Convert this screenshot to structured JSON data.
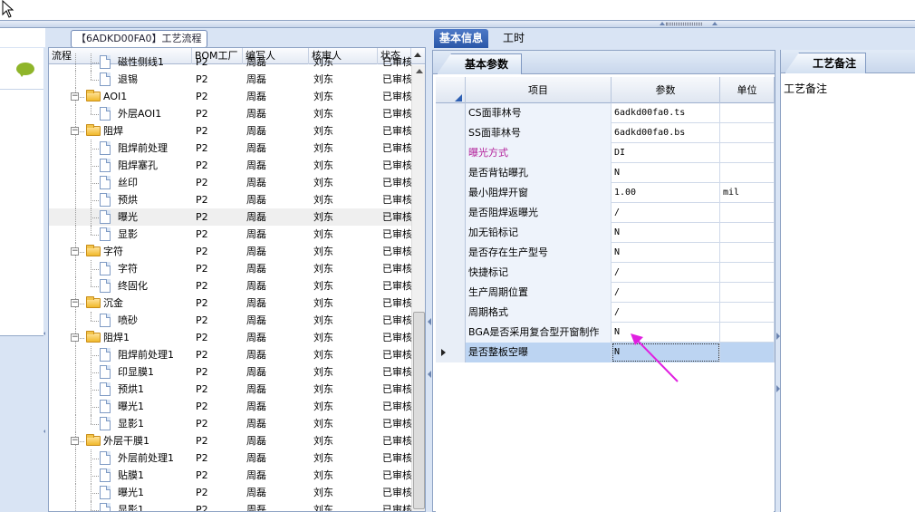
{
  "tree_panel": {
    "title": "【6ADKD00FA0】工艺流程",
    "columns": [
      "流程",
      "BOM工厂",
      "编写人",
      "核审人",
      "状态"
    ],
    "rows": [
      {
        "level": 2,
        "type": "doc",
        "label": "磁性侧线1",
        "bom": "P2",
        "writer": "周磊",
        "reviewer": "刘东",
        "status": "已审核"
      },
      {
        "level": 2,
        "type": "doc",
        "label": "退锡",
        "bom": "P2",
        "writer": "周磊",
        "reviewer": "刘东",
        "status": "已审核"
      },
      {
        "level": 1,
        "type": "folder",
        "label": "AOI1",
        "bom": "P2",
        "writer": "周磊",
        "reviewer": "刘东",
        "status": "已审核"
      },
      {
        "level": 2,
        "type": "doc",
        "label": "外层AOI1",
        "bom": "P2",
        "writer": "周磊",
        "reviewer": "刘东",
        "status": "已审核"
      },
      {
        "level": 1,
        "type": "folder",
        "label": "阻焊",
        "bom": "P2",
        "writer": "周磊",
        "reviewer": "刘东",
        "status": "已审核"
      },
      {
        "level": 2,
        "type": "doc",
        "label": "阻焊前处理",
        "bom": "P2",
        "writer": "周磊",
        "reviewer": "刘东",
        "status": "已审核"
      },
      {
        "level": 2,
        "type": "doc",
        "label": "阻焊塞孔",
        "bom": "P2",
        "writer": "周磊",
        "reviewer": "刘东",
        "status": "已审核"
      },
      {
        "level": 2,
        "type": "doc",
        "label": "丝印",
        "bom": "P2",
        "writer": "周磊",
        "reviewer": "刘东",
        "status": "已审核"
      },
      {
        "level": 2,
        "type": "doc",
        "label": "预烘",
        "bom": "P2",
        "writer": "周磊",
        "reviewer": "刘东",
        "status": "已审核"
      },
      {
        "level": 2,
        "type": "doc",
        "label": "曝光",
        "bom": "P2",
        "writer": "周磊",
        "reviewer": "刘东",
        "status": "已审核",
        "selected": true
      },
      {
        "level": 2,
        "type": "doc",
        "label": "显影",
        "bom": "P2",
        "writer": "周磊",
        "reviewer": "刘东",
        "status": "已审核"
      },
      {
        "level": 1,
        "type": "folder",
        "label": "字符",
        "bom": "P2",
        "writer": "周磊",
        "reviewer": "刘东",
        "status": "已审核"
      },
      {
        "level": 2,
        "type": "doc",
        "label": "字符",
        "bom": "P2",
        "writer": "周磊",
        "reviewer": "刘东",
        "status": "已审核"
      },
      {
        "level": 2,
        "type": "doc",
        "label": "终固化",
        "bom": "P2",
        "writer": "周磊",
        "reviewer": "刘东",
        "status": "已审核"
      },
      {
        "level": 1,
        "type": "folder",
        "label": "沉金",
        "bom": "P2",
        "writer": "周磊",
        "reviewer": "刘东",
        "status": "已审核"
      },
      {
        "level": 2,
        "type": "doc",
        "label": "喷砂",
        "bom": "P2",
        "writer": "周磊",
        "reviewer": "刘东",
        "status": "已审核"
      },
      {
        "level": 1,
        "type": "folder",
        "label": "阻焊1",
        "bom": "P2",
        "writer": "周磊",
        "reviewer": "刘东",
        "status": "已审核"
      },
      {
        "level": 2,
        "type": "doc",
        "label": "阻焊前处理1",
        "bom": "P2",
        "writer": "周磊",
        "reviewer": "刘东",
        "status": "已审核"
      },
      {
        "level": 2,
        "type": "doc",
        "label": "印显膜1",
        "bom": "P2",
        "writer": "周磊",
        "reviewer": "刘东",
        "status": "已审核"
      },
      {
        "level": 2,
        "type": "doc",
        "label": "预烘1",
        "bom": "P2",
        "writer": "周磊",
        "reviewer": "刘东",
        "status": "已审核"
      },
      {
        "level": 2,
        "type": "doc",
        "label": "曝光1",
        "bom": "P2",
        "writer": "周磊",
        "reviewer": "刘东",
        "status": "已审核"
      },
      {
        "level": 2,
        "type": "doc",
        "label": "显影1",
        "bom": "P2",
        "writer": "周磊",
        "reviewer": "刘东",
        "status": "已审核"
      },
      {
        "level": 1,
        "type": "folder",
        "label": "外层干膜1",
        "bom": "P2",
        "writer": "周磊",
        "reviewer": "刘东",
        "status": "已审核"
      },
      {
        "level": 2,
        "type": "doc",
        "label": "外层前处理1",
        "bom": "P2",
        "writer": "周磊",
        "reviewer": "刘东",
        "status": "已审核"
      },
      {
        "level": 2,
        "type": "doc",
        "label": "贴膜1",
        "bom": "P2",
        "writer": "周磊",
        "reviewer": "刘东",
        "status": "已审核"
      },
      {
        "level": 2,
        "type": "doc",
        "label": "曝光1",
        "bom": "P2",
        "writer": "周磊",
        "reviewer": "刘东",
        "status": "已审核"
      },
      {
        "level": 2,
        "type": "doc",
        "label": "显影1",
        "bom": "P2",
        "writer": "周磊",
        "reviewer": "刘东",
        "status": "已审核"
      }
    ]
  },
  "main_tabs": [
    {
      "label": "基本信息",
      "active": true
    },
    {
      "label": "工时",
      "active": false
    }
  ],
  "params_pane": {
    "tab_label": "基本参数",
    "columns": [
      "项目",
      "参数",
      "单位"
    ],
    "rows": [
      {
        "item": "CS面菲林号",
        "value": "6adkd00fa0.ts",
        "unit": ""
      },
      {
        "item": "SS面菲林号",
        "value": "6adkd00fa0.bs",
        "unit": ""
      },
      {
        "item": "曝光方式",
        "value": "DI",
        "unit": "",
        "highlight": true
      },
      {
        "item": "是否背钻曝孔",
        "value": "N",
        "unit": ""
      },
      {
        "item": "最小阻焊开窗",
        "value": "1.00",
        "unit": "mil"
      },
      {
        "item": "是否阻焊返曝光",
        "value": "/",
        "unit": ""
      },
      {
        "item": "加无铅标记",
        "value": "N",
        "unit": ""
      },
      {
        "item": "是否存在生产型号",
        "value": "N",
        "unit": ""
      },
      {
        "item": "快捷标记",
        "value": "/",
        "unit": ""
      },
      {
        "item": "生产周期位置",
        "value": "/",
        "unit": ""
      },
      {
        "item": "周期格式",
        "value": "/",
        "unit": ""
      },
      {
        "item": "BGA是否采用复合型开窗制作",
        "value": "N",
        "unit": ""
      },
      {
        "item": "是否整板空曝",
        "value": "N",
        "unit": "",
        "selected": true
      }
    ]
  },
  "notes_pane": {
    "tab_label": "工艺备注",
    "label": "工艺备注"
  },
  "colors": {
    "accent_tab": "#2a57a8",
    "highlight_text": "#b3209a",
    "annotation_arrow": "#e020e0",
    "speech_bubble": "#8fb52a"
  }
}
